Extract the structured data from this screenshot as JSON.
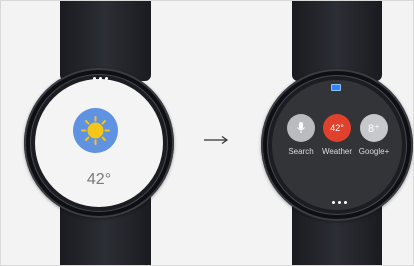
{
  "left_watch": {
    "weather_icon": "sun-icon",
    "temperature": "42°"
  },
  "transition": {
    "icon": "right-arrow-icon"
  },
  "right_watch": {
    "status_icon": "battery-icon",
    "apps": [
      {
        "label": "Search",
        "icon": "microphone-icon",
        "color": "#b9bbbf",
        "glyph": ""
      },
      {
        "label": "Weather",
        "icon": "temperature-badge",
        "color": "#e0412d",
        "glyph": "42°"
      },
      {
        "label": "Google+",
        "icon": "google-plus-icon",
        "color": "#c7c8cc",
        "glyph": "8⁺"
      }
    ]
  },
  "colors": {
    "background": "#f3f3f3",
    "strap": "#24262c",
    "sun_circle": "#5f93e2",
    "sun": "#f5c518",
    "weather_badge": "#e0412d",
    "battery": "#2f83ff"
  }
}
